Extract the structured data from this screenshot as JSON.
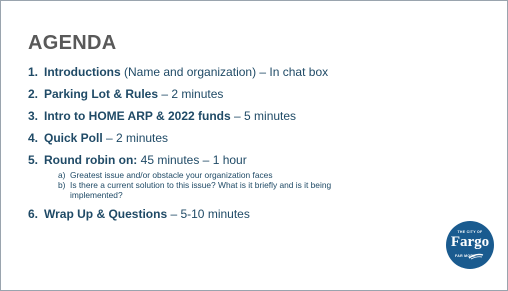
{
  "slide": {
    "title": "AGENDA",
    "items": [
      {
        "num": "1.",
        "name": "Introductions",
        "rest": " (Name and organization) – In chat box"
      },
      {
        "num": "2.",
        "name": "Parking Lot & Rules",
        "rest": " – 2 minutes"
      },
      {
        "num": "3.",
        "name": "Intro to HOME ARP & 2022 funds",
        "rest": " – 5 minutes"
      },
      {
        "num": "4.",
        "name": "Quick Poll",
        "rest": " – 2 minutes"
      },
      {
        "num": "5.",
        "name": "Round robin on:",
        "rest": " 45 minutes – 1 hour",
        "subitems": [
          {
            "letter": "a)",
            "text": "Greatest issue and/or obstacle your organization faces"
          },
          {
            "letter": "b)",
            "text": "Is there a current solution to this issue? What is it briefly and is it being implemented?"
          }
        ]
      },
      {
        "num": "6.",
        "name": "Wrap Up & Questions",
        "rest": " – 5-10 minutes"
      }
    ]
  },
  "logo": {
    "top_text": "THE CITY OF",
    "main_text": "Fargo",
    "bottom_text": "FAR MORE"
  },
  "colors": {
    "title": "#595959",
    "body_text": "#1f4a66",
    "logo_background": "#1a5b8f",
    "border": "#9aa4ae"
  }
}
